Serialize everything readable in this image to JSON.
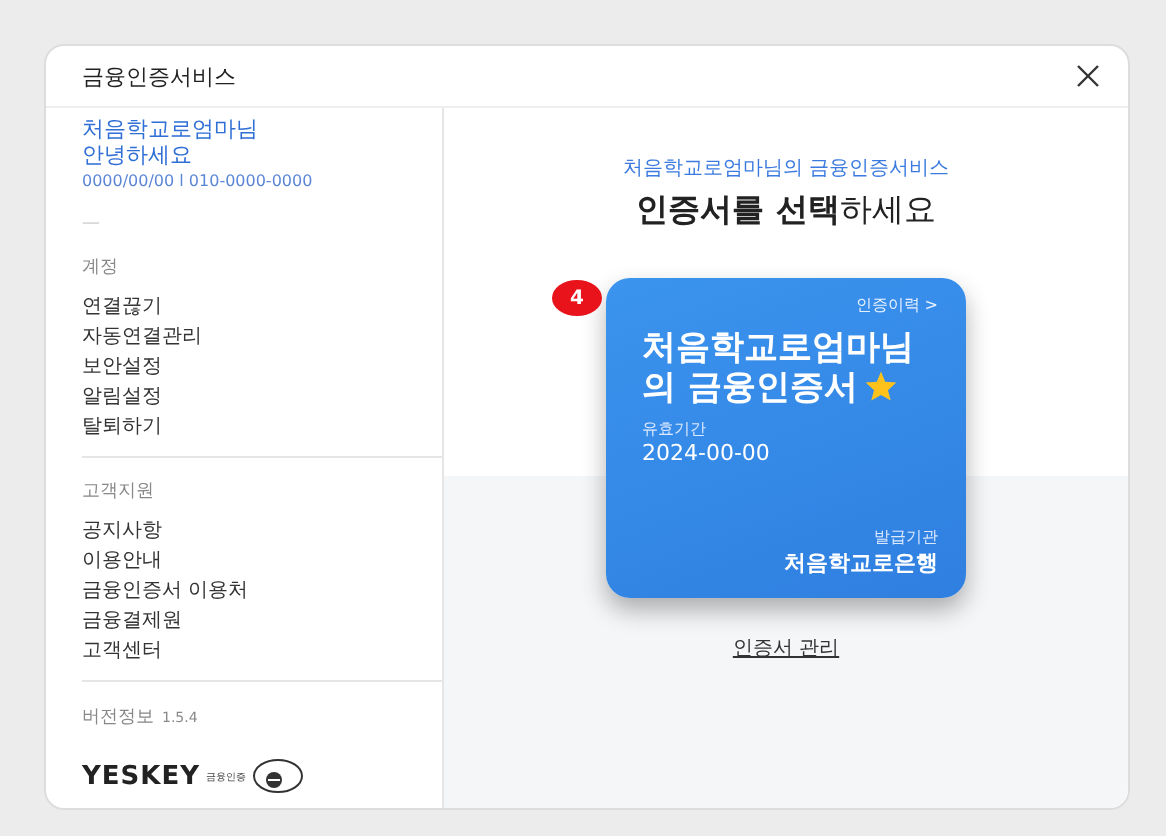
{
  "window": {
    "title": "금융인증서비스"
  },
  "sidebar": {
    "user": {
      "name": "처음학교로엄마님",
      "greeting": "안녕하세요",
      "info": "0000/00/00 l 010-0000-0000"
    },
    "dash": "—",
    "sections": [
      {
        "title": "계정",
        "items": [
          "연결끊기",
          "자동연결관리",
          "보안설정",
          "알림설정",
          "탈퇴하기"
        ]
      },
      {
        "title": "고객지원",
        "items": [
          "공지사항",
          "이용안내",
          "금융인증서 이용처",
          "금융결제원\n고객센터"
        ]
      }
    ],
    "version": {
      "label": "버전정보",
      "number": "1.5.4"
    },
    "logo": {
      "brand": "YESKEY",
      "tagline": "금융인증"
    }
  },
  "main": {
    "subtitle": "처음학교로엄마님의 금융인증서비스",
    "heading": "**인증서를 선택**하세요",
    "certificate": {
      "badge": "4",
      "history_link": "인증이력 >",
      "title": "처음학교로엄마님의 금융인증서",
      "favorite": true,
      "validity_label": "유효기간",
      "validity_date": "2024-00-00",
      "issuer_label": "발급기관",
      "issuer": "처음학교로은행"
    },
    "manage_link": "인증서 관리"
  }
}
